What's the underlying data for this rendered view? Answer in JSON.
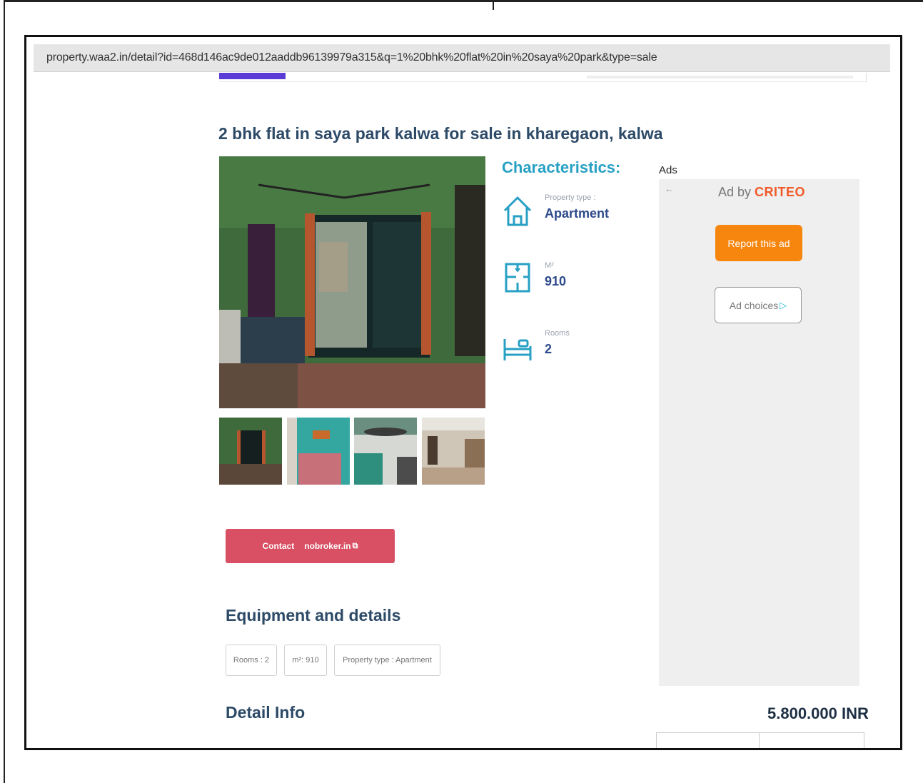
{
  "browser": {
    "url": "property.waa2.in/detail?id=468d146ac9de012aaddb96139979a315&q=1%20bhk%20flat%20in%20saya%20park&type=sale"
  },
  "listing": {
    "title": "2 bhk flat in saya park kalwa for sale in kharegaon, kalwa",
    "price": "5.800.000 INR"
  },
  "characteristics": {
    "heading": "Characteristics:",
    "items": [
      {
        "label": "Property type :",
        "value": "Apartment",
        "icon": "house-icon"
      },
      {
        "label": "M²",
        "value": "910",
        "icon": "floorplan-icon"
      },
      {
        "label": "Rooms",
        "value": "2",
        "icon": "bed-icon"
      }
    ]
  },
  "ads": {
    "label": "Ads",
    "back_glyph": "←",
    "ad_by": "Ad by ",
    "brand": "CRITEO",
    "report_label": "Report this ad",
    "choices_label": "Ad choices",
    "choices_glyph": "▷"
  },
  "contact": {
    "label": "Contact",
    "site": "nobroker.in",
    "ext_glyph": "⧉"
  },
  "equipment": {
    "heading": "Equipment and details",
    "chips": [
      "Rooms : 2",
      "m²: 910",
      "Property type : Apartment"
    ]
  },
  "detail_info": {
    "heading": "Detail Info"
  },
  "colors": {
    "accent_purple": "#5b3bd6",
    "title_navy": "#2d4a67",
    "char_teal": "#27a0c4",
    "contact_red": "#d94f63",
    "report_orange": "#f7860f"
  }
}
